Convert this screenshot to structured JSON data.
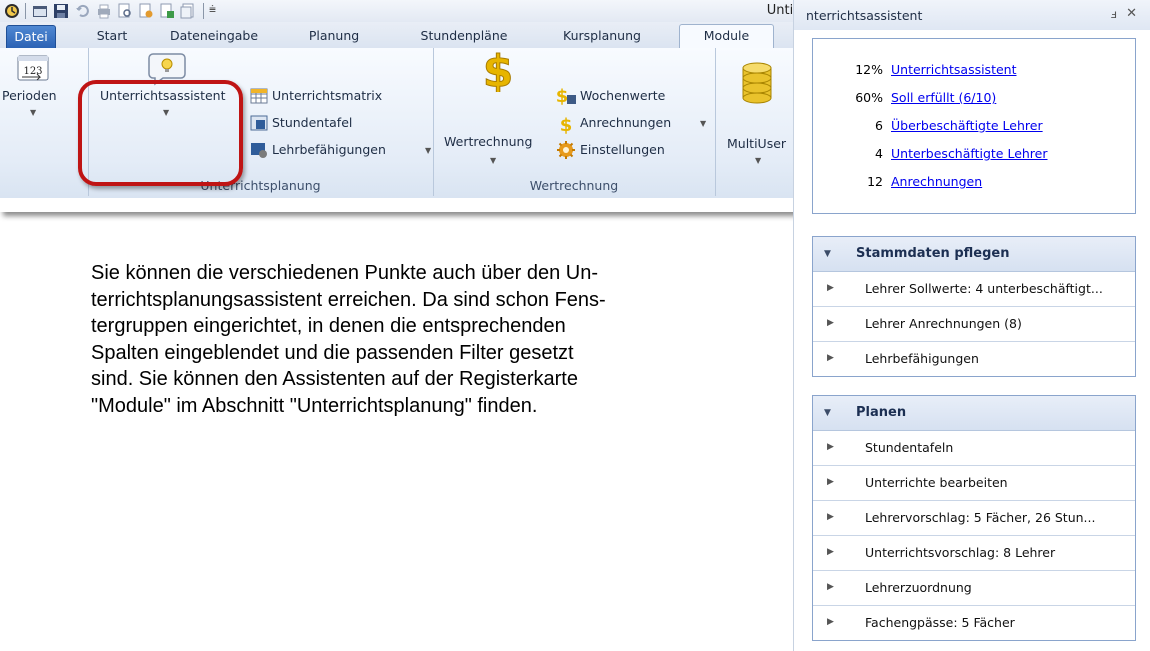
{
  "window": {
    "title_fragment": "Untis"
  },
  "ribbon": {
    "tabs": [
      "Datei",
      "Start",
      "Dateneingabe",
      "Planung",
      "Stundenpläne",
      "Kursplanung",
      "Module"
    ],
    "active_tab": "Module",
    "groups": {
      "perioden": {
        "button": "Perioden",
        "icon_text": "123"
      },
      "unterrichtsplanung": {
        "label": "Unterrichtsplanung",
        "assistant_button": "Unterrichtsassistent",
        "items": [
          "Unterrichtsmatrix",
          "Stundentafel",
          "Lehrbefähigungen"
        ]
      },
      "wertrechnung": {
        "label": "Wertrechnung",
        "big_button": "Wertrechnung",
        "items": [
          "Wochenwerte",
          "Anrechnungen",
          "Einstellungen"
        ]
      },
      "multiuser": {
        "button": "MultiUser"
      }
    }
  },
  "paragraph": {
    "lines": [
      "Sie können die verschiedenen Punkte auch über den Un-",
      "terrichtsplanungsassistent erreichen. Da sind schon Fens-",
      "tergruppen eingerichtet, in denen die entsprechenden",
      "Spalten eingeblendet und die passenden Filter gesetzt",
      "sind. Sie können den Assistenten auf der Registerkarte",
      "\"Module\" im Abschnitt \"Unterrichtsplanung\" finden."
    ]
  },
  "pane": {
    "title": "nterrichtsassistent",
    "pin_symbol": "ⅎ",
    "close_symbol": "✕",
    "summary": [
      {
        "value": "12%",
        "label": "Unterrichtsassistent"
      },
      {
        "value": "60%",
        "label": "Soll erfüllt (6/10)"
      },
      {
        "value": "6",
        "label": "Überbeschäftigte Lehrer"
      },
      {
        "value": "4",
        "label": "Unterbeschäftigte Lehrer"
      },
      {
        "value": "12",
        "label": "Anrechnungen"
      }
    ],
    "sections": [
      {
        "title": "Stammdaten pflegen",
        "items": [
          "Lehrer Sollwerte: 4 unterbeschäftigt...",
          "Lehrer Anrechnungen (8)",
          "Lehrbefähigungen"
        ]
      },
      {
        "title": "Planen",
        "items": [
          "Stundentafeln",
          "Unterrichte bearbeiten",
          "Lehrervorschlag: 5 Fächer, 26 Stun...",
          "Unterrichtsvorschlag: 8 Lehrer",
          "Lehrerzuordnung",
          "Fachengpässe: 5 Fächer"
        ]
      }
    ]
  },
  "colors": {
    "highlight": "#bf1414",
    "link": "#0000ee",
    "file_tab": "#2a61b3",
    "currency_gold": "#e7b500"
  }
}
